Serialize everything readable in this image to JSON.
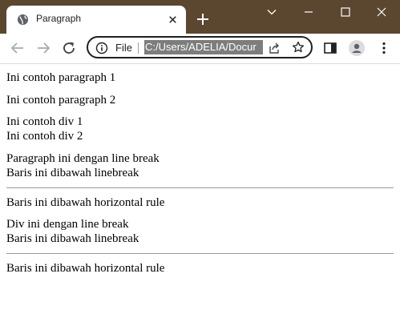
{
  "window": {
    "tab_title": "Paragraph",
    "controls": {
      "minimize": "minimize-icon",
      "maximize": "maximize-icon",
      "close": "close-icon",
      "tab_search": "chevron-down-icon"
    }
  },
  "toolbar": {
    "scheme_label": "File",
    "url": "C:/Users/ADELIA/Docur"
  },
  "content": {
    "p1": "Ini contoh paragraph 1",
    "p2": "Ini contoh paragraph 2",
    "div1": "Ini contoh div 1",
    "div2": "Ini contoh div 2",
    "p3_line1": "Paragraph ini dengan line break",
    "p3_line2": "Baris ini dibawah linebreak",
    "after_hr1": "Baris ini dibawah horizontal rule",
    "div3_line1": "Div ini dengan line break",
    "div3_line2": "Baris ini dibawah linebreak",
    "after_hr2": "Baris ini dibawah horizontal rule"
  },
  "colors": {
    "titlebar": "#5b4630",
    "omnibox_border": "#1f1f1f",
    "url_selection": "#7d7d7d"
  }
}
